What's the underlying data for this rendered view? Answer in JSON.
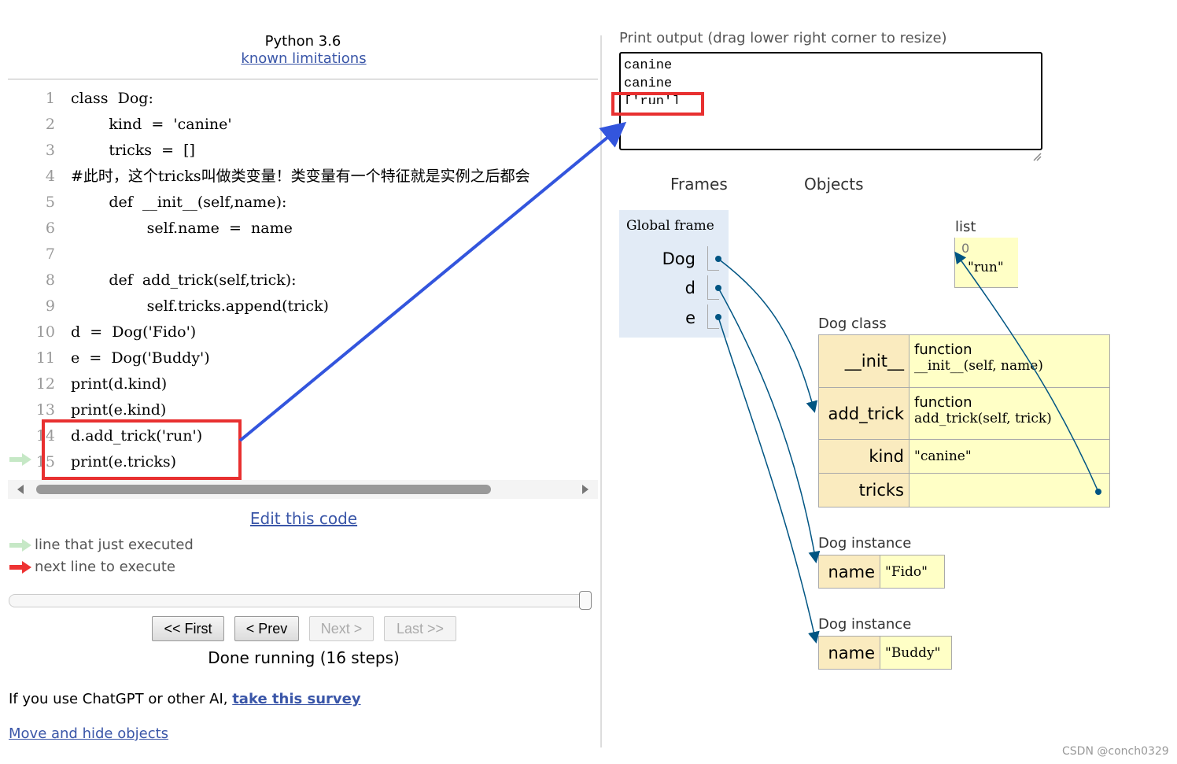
{
  "header": {
    "python_version": "Python 3.6",
    "known_limitations": "known limitations"
  },
  "code": [
    {
      "n": "1",
      "text": "class  Dog:"
    },
    {
      "n": "2",
      "text": "        kind  =  'canine'"
    },
    {
      "n": "3",
      "text": "        tricks  =  []"
    },
    {
      "n": "4",
      "text": "#此时，这个tricks叫做类变量！类变量有一个特征就是实例之后都会"
    },
    {
      "n": "5",
      "text": "        def  __init__(self,name):"
    },
    {
      "n": "6",
      "text": "                self.name  =  name"
    },
    {
      "n": "7",
      "text": ""
    },
    {
      "n": "8",
      "text": "        def  add_trick(self,trick):"
    },
    {
      "n": "9",
      "text": "                self.tricks.append(trick)"
    },
    {
      "n": "10",
      "text": "d  =  Dog('Fido')"
    },
    {
      "n": "11",
      "text": "e  =  Dog('Buddy')"
    },
    {
      "n": "12",
      "text": "print(d.kind)"
    },
    {
      "n": "13",
      "text": "print(e.kind)"
    },
    {
      "n": "14",
      "text": "d.add_trick('run')"
    },
    {
      "n": "15",
      "text": "print(e.tricks)"
    }
  ],
  "edit_link": "Edit this code",
  "legend": {
    "just_executed": "line that just executed",
    "next_line": "next line to execute"
  },
  "nav": {
    "first": "<< First",
    "prev": "< Prev",
    "next": "Next >",
    "last": "Last >>"
  },
  "status": "Done running (16 steps)",
  "survey": {
    "prefix": "If you use ChatGPT or other AI, ",
    "link": "take this survey"
  },
  "move_hide": "Move and hide objects",
  "print_output": {
    "label": "Print output (drag lower right corner to resize)",
    "lines": [
      "canine",
      "canine",
      "['run']"
    ]
  },
  "frames_header": "Frames",
  "objects_header": "Objects",
  "global_frame": {
    "title": "Global frame",
    "vars": [
      "Dog",
      "d",
      "e"
    ]
  },
  "list_obj": {
    "label": "list",
    "index": "0",
    "value": "\"run\""
  },
  "dog_class": {
    "label": "Dog class",
    "rows": [
      {
        "key": "__init__",
        "type": "function",
        "sig": "__init__(self, name)"
      },
      {
        "key": "add_trick",
        "type": "function",
        "sig": "add_trick(self, trick)"
      },
      {
        "key": "kind",
        "value": "\"canine\""
      },
      {
        "key": "tricks",
        "value": ""
      }
    ]
  },
  "instance1": {
    "label": "Dog instance",
    "key": "name",
    "value": "\"Fido\""
  },
  "instance2": {
    "label": "Dog instance",
    "key": "name",
    "value": "\"Buddy\""
  },
  "watermark": "CSDN @conch0329",
  "colors": {
    "link": "#3a56a8",
    "green_arrow": "#c6e8c6",
    "red_arrow": "#e33",
    "pointer": "#005583",
    "annotation": "#e83030",
    "blue_annot": "#3355dd"
  }
}
